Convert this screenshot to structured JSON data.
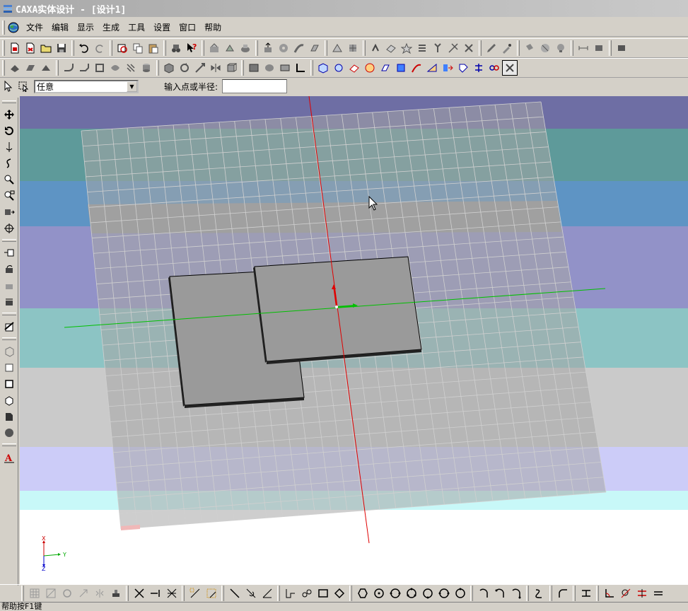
{
  "window": {
    "title": "CAXA实体设计 - [设计1]"
  },
  "menu": {
    "items": [
      "文件",
      "编辑",
      "显示",
      "生成",
      "工具",
      "设置",
      "窗口",
      "帮助"
    ]
  },
  "command_bar": {
    "select_combo_value": "任意",
    "input_label": "输入点或半径:",
    "input_value": ""
  },
  "axis_triad": {
    "x_label": "X",
    "y_label": "Y",
    "z_label": "Z"
  },
  "status": {
    "text": "帮助按F1键"
  },
  "colors": {
    "bands": [
      "#6e6ea4",
      "#5e9a9a",
      "#5e94c4",
      "#9292c8",
      "#8cc4c4",
      "#cacaca",
      "#ccccf8",
      "#c8f8f8",
      "#ffffff"
    ],
    "grid_fill": "#a6a6a6",
    "grid_line": "#d0d0d0",
    "red_axis": "#e00000",
    "green_axis": "#00c000"
  }
}
